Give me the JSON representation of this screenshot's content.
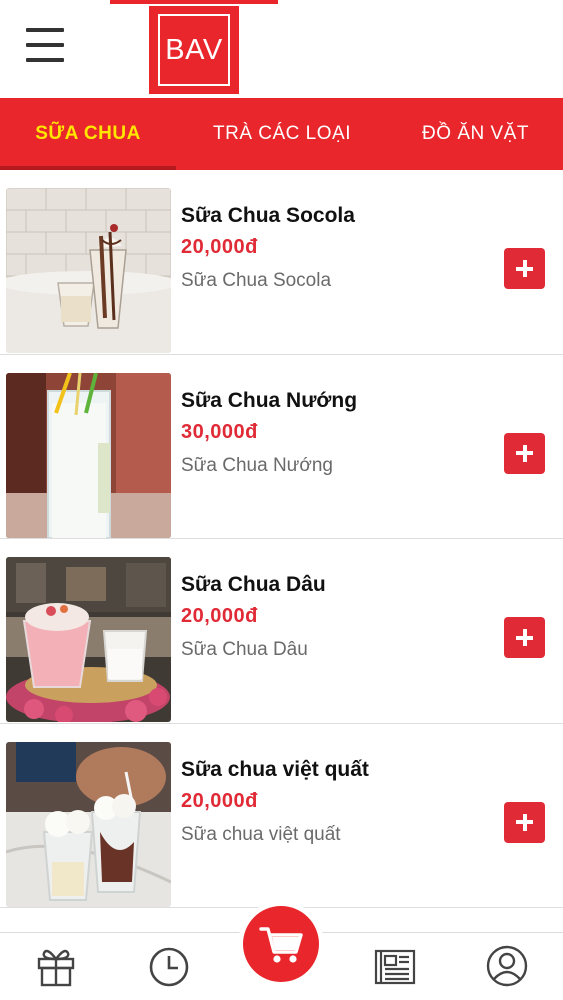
{
  "header": {
    "logo_text": "BAV",
    "brand_color": "#e8262b"
  },
  "tabs": [
    {
      "label": "SỮA CHUA",
      "active": true
    },
    {
      "label": "TRÀ CÁC LOẠI",
      "active": false
    },
    {
      "label": "ĐỒ ĂN VẶT",
      "active": false
    }
  ],
  "products": [
    {
      "name": "Sữa Chua Socola",
      "price": "20,000đ",
      "description": "Sữa Chua Socola"
    },
    {
      "name": "Sữa Chua Nướng",
      "price": "30,000đ",
      "description": "Sữa Chua Nướng"
    },
    {
      "name": "Sữa Chua Dâu",
      "price": "20,000đ",
      "description": "Sữa Chua Dâu"
    },
    {
      "name": "Sữa chua việt quất",
      "price": "20,000đ",
      "description": "Sữa chua việt quất"
    }
  ],
  "bottom_nav": {
    "items": [
      "gift-icon",
      "clock-icon",
      "cart-icon",
      "newspaper-icon",
      "user-icon"
    ],
    "accent": "#e8262b"
  },
  "colors": {
    "price": "#e02a36",
    "active_tab": "#ffe600"
  }
}
